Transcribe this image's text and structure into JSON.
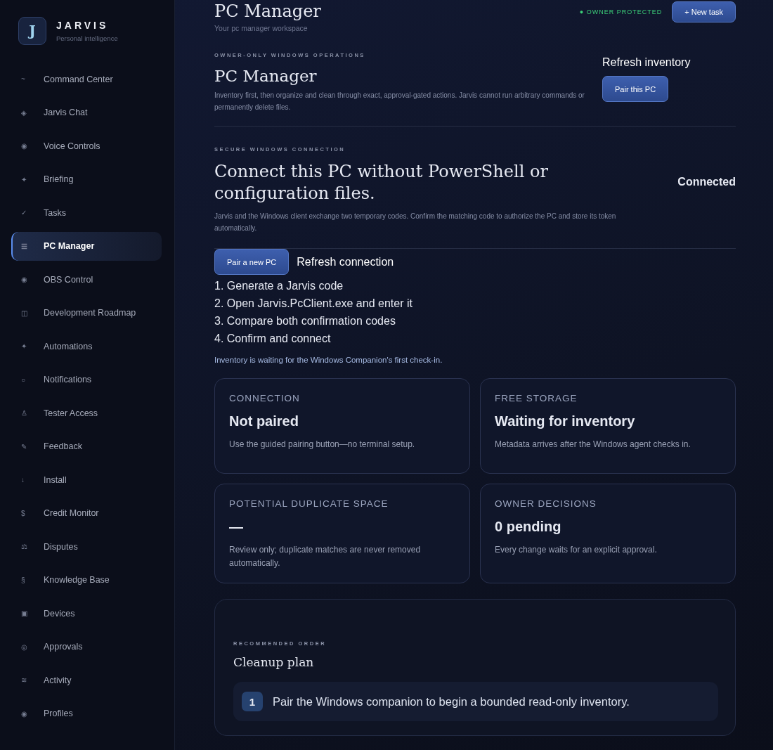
{
  "brand": {
    "logo": "J",
    "name": "JARVIS",
    "tagline": "Personal intelligence"
  },
  "sidebar": {
    "items": [
      {
        "icon": "~",
        "label": "Command Center",
        "selected": false
      },
      {
        "icon": "◈",
        "label": "Jarvis Chat",
        "selected": false
      },
      {
        "icon": "◉",
        "label": "Voice Controls",
        "selected": false
      },
      {
        "icon": "✦",
        "label": "Briefing",
        "selected": false
      },
      {
        "icon": "✓",
        "label": "Tasks",
        "selected": false
      },
      {
        "icon": "☰",
        "label": "PC Manager",
        "selected": true
      },
      {
        "icon": "◉",
        "label": "OBS Control",
        "selected": false
      },
      {
        "icon": "◫",
        "label": "Development Roadmap",
        "selected": false
      },
      {
        "icon": "✦",
        "label": "Automations",
        "selected": false
      },
      {
        "icon": "○",
        "label": "Notifications",
        "selected": false
      },
      {
        "icon": "♙",
        "label": "Tester Access",
        "selected": false
      },
      {
        "icon": "✎",
        "label": "Feedback",
        "selected": false
      },
      {
        "icon": "↓",
        "label": "Install",
        "selected": false
      },
      {
        "icon": "$",
        "label": "Credit Monitor",
        "selected": false
      },
      {
        "icon": "⚖",
        "label": "Disputes",
        "selected": false
      },
      {
        "icon": "§",
        "label": "Knowledge Base",
        "selected": false
      },
      {
        "icon": "▣",
        "label": "Devices",
        "selected": false
      },
      {
        "icon": "◎",
        "label": "Approvals",
        "selected": false
      },
      {
        "icon": "≋",
        "label": "Activity",
        "selected": false
      },
      {
        "icon": "◉",
        "label": "Profiles",
        "selected": false
      }
    ]
  },
  "header": {
    "title": "PC Manager",
    "subtitle": "Your pc manager workspace",
    "status": "● OWNER PROTECTED",
    "new_task_button": "+ New task"
  },
  "operations": {
    "eyebrow": "OWNER-ONLY WINDOWS OPERATIONS",
    "title": "PC Manager",
    "description": "Inventory first, then organize and clean through exact, approval-gated actions. Jarvis cannot run arbitrary commands or permanently delete files.",
    "refresh_link": "Refresh inventory",
    "pair_button": "Pair this PC"
  },
  "connection": {
    "eyebrow": "SECURE WINDOWS CONNECTION",
    "title": "Connect this PC without PowerShell or configuration files.",
    "status": "Connected",
    "description": "Jarvis and the Windows client exchange two temporary codes. Confirm the matching code to authorize the PC and store its token automatically.",
    "pair_button": "Pair a new PC",
    "refresh_link": "Refresh connection",
    "steps": [
      "1. Generate a Jarvis code",
      "2. Open Jarvis.PcClient.exe and enter it",
      "3. Compare both confirmation codes",
      "4. Confirm and connect"
    ],
    "notice": "Inventory is waiting for the Windows Companion's first check-in."
  },
  "stats": [
    {
      "label": "CONNECTION",
      "value": "Not paired",
      "note": "Use the guided pairing button—no terminal setup."
    },
    {
      "label": "FREE STORAGE",
      "value": "Waiting for inventory",
      "note": "Metadata arrives after the Windows agent checks in."
    },
    {
      "label": "POTENTIAL DUPLICATE SPACE",
      "value": "—",
      "note": "Review only; duplicate matches are never removed automatically."
    },
    {
      "label": "OWNER DECISIONS",
      "value": "0 pending",
      "note": "Every change waits for an explicit approval."
    }
  ],
  "plan": {
    "eyebrow": "RECOMMENDED ORDER",
    "title": "Cleanup plan",
    "steps": [
      {
        "number": "1",
        "text": "Pair the Windows companion to begin a bounded read-only inventory."
      }
    ]
  }
}
